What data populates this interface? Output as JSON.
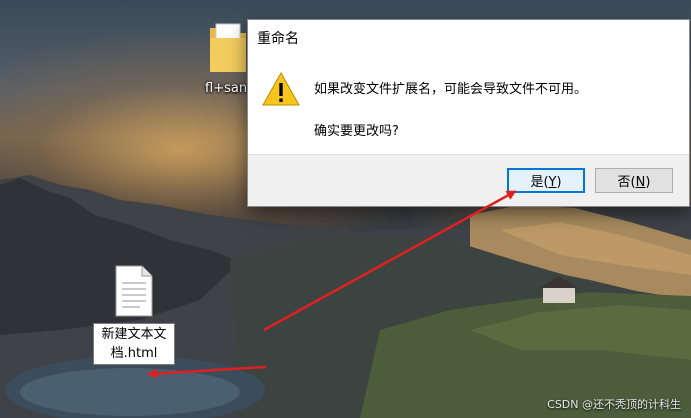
{
  "desktop": {
    "folder": {
      "label": "fl+san",
      "icon": "folder-icon"
    },
    "file": {
      "label_line1": "新建文本文",
      "label_line2": "档.html",
      "icon": "text-file-icon"
    }
  },
  "dialog": {
    "title": "重命名",
    "icon": "warning-icon",
    "message": "如果改变文件扩展名，可能会导致文件不可用。",
    "question": "确实要更改吗?",
    "yes_text": "是(",
    "yes_key": "Y",
    "yes_close": ")",
    "no_text": "否(",
    "no_key": "N",
    "no_close": ")"
  },
  "annotations": {
    "arrow_color": "#e02020",
    "arrows": [
      "red-arrow-to-yes-button",
      "red-arrow-to-file-label"
    ]
  },
  "watermark": "CSDN @还不秃顶的计科生",
  "colors": {
    "accent": "#0078d7",
    "warning": "#f7c51d",
    "dialog_footer": "#f0f0f0"
  }
}
